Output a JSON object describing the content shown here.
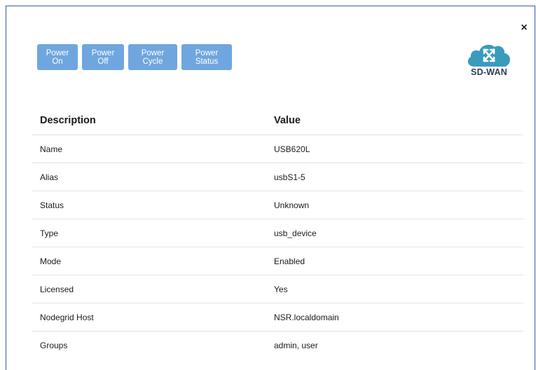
{
  "toolbar": {
    "buttons": [
      {
        "label": "Power On"
      },
      {
        "label": "Power Off"
      },
      {
        "label": "Power Cycle"
      },
      {
        "label": "Power Status"
      }
    ]
  },
  "close_label": "×",
  "logo": {
    "text": "SD-WAN",
    "icon": "cloud-arrows-icon",
    "color": "#3a9bbd"
  },
  "table": {
    "headers": [
      "Description",
      "Value"
    ],
    "rows": [
      {
        "description": "Name",
        "value": "USB620L"
      },
      {
        "description": "Alias",
        "value": "usbS1-5"
      },
      {
        "description": "Status",
        "value": "Unknown"
      },
      {
        "description": "Type",
        "value": "usb_device"
      },
      {
        "description": "Mode",
        "value": "Enabled"
      },
      {
        "description": "Licensed",
        "value": "Yes"
      },
      {
        "description": "Nodegrid Host",
        "value": "NSR.localdomain"
      },
      {
        "description": "Groups",
        "value": "admin, user"
      }
    ]
  },
  "colors": {
    "button": "#6fa6df",
    "border": "#3d5a9a",
    "logo": "#3a9bbd"
  }
}
